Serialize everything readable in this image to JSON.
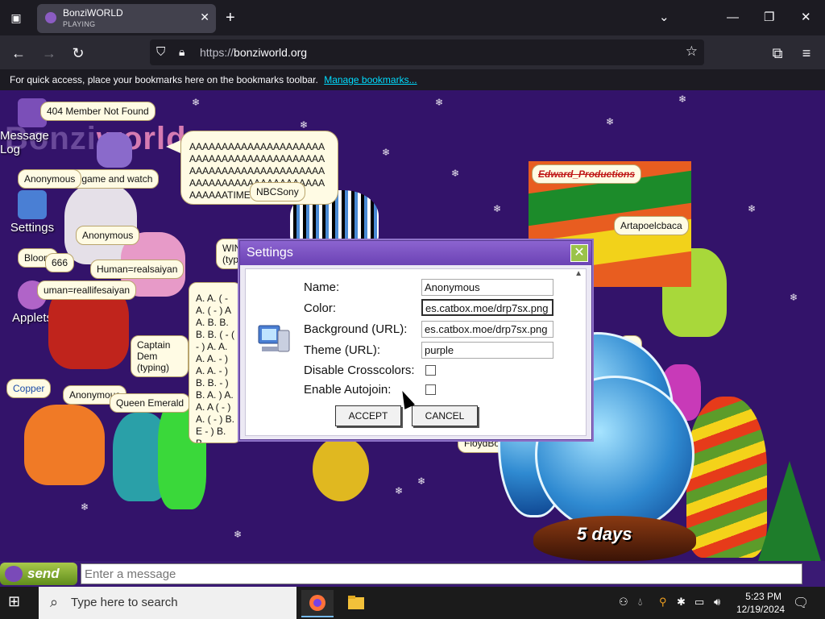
{
  "browser": {
    "tab_title": "BonziWORLD",
    "tab_subtitle": "PLAYING",
    "url_protocol": "https://",
    "url_host": "bonziworld.org",
    "bookmarks_hint": "For quick access, place your bookmarks here on the bookmarks toolbar.",
    "manage_bookmarks": "Manage bookmarks..."
  },
  "desktop_icons": {
    "message_log": "Message Log",
    "settings": "Settings",
    "applets": "Applets"
  },
  "chat": {
    "big_message": "AAAAAAAAAAAAAAAAAAAAAAAAAAAAAAAAAAAAAAAAAAAAAAAAAAAAAAAAAAAAAAAAAAAAAAAAAAAAAAAAAAAAAAAAAATIME!",
    "ab_message": "A. A. ( - A. ( - ) A A. B. B. B. B. ( - ( - ) A. A. A. A. - ) A. A. - ) B. B. - ) B. A. ) A. A. A ( - ) A. ( - ) B. E - ) B. B."
  },
  "usernames": {
    "member_404": "404 Member Not Found",
    "game_watch": "r game and watch",
    "anonymous1": "Anonymous",
    "anonymous2": "Anonymous",
    "anonymous3": "Anonymous",
    "bloom": "Bloom",
    "n666": "666",
    "realsaiyan": "Human=realsaiyan",
    "reallifesaiyan": "uman=reallifesaiyan",
    "captain": "Captain Dem (typing)",
    "copper": "Copper",
    "queen_emerald": "Queen Emerald",
    "nbc": "NBCSony",
    "win": "WIN (typ",
    "edward": "Edward_Productions",
    "artapoel": "Artapoelcbaca",
    "floyd": "FloydBo",
    "gus": "us"
  },
  "settings_dialog": {
    "title": "Settings",
    "close_glyph": "✕",
    "fields": [
      {
        "label": "Name:",
        "value": "Anonymous"
      },
      {
        "label": "Color:",
        "value": "es.catbox.moe/drp7sx.png"
      },
      {
        "label": "Background (URL):",
        "value": "es.catbox.moe/drp7sx.png"
      },
      {
        "label": "Theme (URL):",
        "value": "purple"
      }
    ],
    "checkboxes": [
      {
        "label": "Disable Crosscolors:",
        "checked": false
      },
      {
        "label": "Enable Autojoin:",
        "checked": false
      }
    ],
    "accept": "ACCEPT",
    "cancel": "CANCEL"
  },
  "countdown": "5 days",
  "chatbar": {
    "send_label": "send",
    "placeholder": "Enter a message"
  },
  "taskbar": {
    "search_placeholder": "Type here to search",
    "time": "5:23 PM",
    "date": "12/19/2024"
  },
  "colors": {
    "page_background": "#33136a",
    "dialog_title": "#6b42b4",
    "send_button": "#5f8c1c"
  }
}
